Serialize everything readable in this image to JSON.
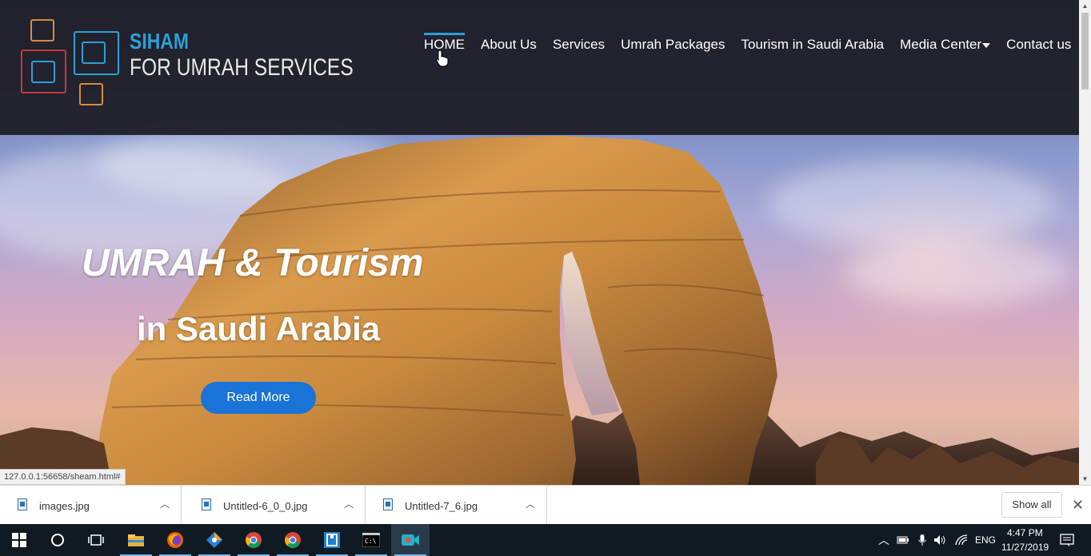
{
  "brand": {
    "name": "SIHAM",
    "tagline": "FOR UMRAH SERVICES"
  },
  "nav": {
    "items": [
      {
        "label": "HOME",
        "active": true
      },
      {
        "label": "About Us"
      },
      {
        "label": "Services"
      },
      {
        "label": "Umrah Packages"
      },
      {
        "label": "Tourism in Saudi Arabia"
      },
      {
        "label": "Media Center",
        "dropdown": true
      },
      {
        "label": "Contact us"
      }
    ]
  },
  "hero": {
    "title": "UMRAH & Tourism",
    "subtitle": "in Saudi Arabia",
    "button": "Read More"
  },
  "browser": {
    "status_url": "127.0.0.1:56658/sheam.html#"
  },
  "downloads": {
    "items": [
      {
        "name": "images.jpg"
      },
      {
        "name": "Untitled-6_0_0.jpg"
      },
      {
        "name": "Untitled-7_6.jpg"
      }
    ],
    "show_all": "Show all"
  },
  "taskbar": {
    "apps": [
      "start-icon",
      "cortana-icon",
      "task-view-icon",
      "file-explorer-icon",
      "firefox-icon",
      "sourcetree-icon",
      "chrome-icon",
      "chrome-icon",
      "brackets-icon",
      "terminal-icon",
      "screen-recorder-icon"
    ],
    "tray": {
      "language": "ENG",
      "time": "4:47 PM",
      "date": "11/27/2019"
    }
  },
  "colors": {
    "accent": "#2ea0d6",
    "logo_orange": "#d98b3f",
    "logo_red": "#c7373b",
    "button_blue": "#1a73d6",
    "header_bg": "#1c1c24"
  }
}
